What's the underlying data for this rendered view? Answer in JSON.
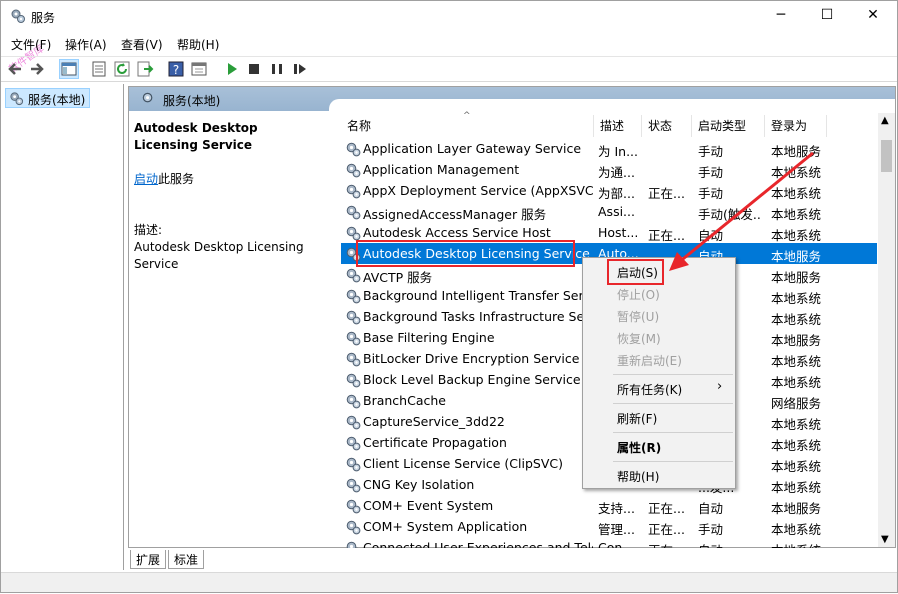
{
  "window": {
    "title": "服务",
    "watermark": "软件智库"
  },
  "menu": [
    "文件(F)",
    "操作(A)",
    "查看(V)",
    "帮助(H)"
  ],
  "tree": {
    "root_label": "服务(本地)"
  },
  "pane": {
    "header": "服务(本地)"
  },
  "description": {
    "service_name": "Autodesk Desktop Licensing Service",
    "start_link": "启动",
    "start_suffix": "此服务",
    "desc_label": "描述:",
    "desc_text": "Autodesk Desktop Licensing Service"
  },
  "columns": [
    "名称",
    "描述",
    "状态",
    "启动类型",
    "登录为"
  ],
  "services": [
    {
      "name": "Application Layer Gateway Service",
      "desc": "为 In...",
      "status": "",
      "startup": "手动",
      "logon": "本地服务"
    },
    {
      "name": "Application Management",
      "desc": "为通...",
      "status": "",
      "startup": "手动",
      "logon": "本地系统"
    },
    {
      "name": "AppX Deployment Service (AppXSVC)",
      "desc": "为部...",
      "status": "正在...",
      "startup": "手动",
      "logon": "本地系统"
    },
    {
      "name": "AssignedAccessManager 服务",
      "desc": "Assi...",
      "status": "",
      "startup": "手动(触发...",
      "logon": "本地系统"
    },
    {
      "name": "Autodesk Access Service Host",
      "desc": "Host...",
      "status": "正在...",
      "startup": "自动",
      "logon": "本地系统"
    },
    {
      "name": "Autodesk Desktop Licensing Service",
      "desc": "Auto...",
      "status": "",
      "startup": "自动",
      "logon": "本地服务"
    },
    {
      "name": "AVCTP 服务",
      "desc": "",
      "status": "",
      "startup": "",
      "logon": "本地服务"
    },
    {
      "name": "Background Intelligent Transfer Service",
      "desc": "",
      "status": "",
      "startup": "",
      "logon": "本地系统"
    },
    {
      "name": "Background Tasks Infrastructure Service",
      "desc": "",
      "status": "",
      "startup": "",
      "logon": "本地系统"
    },
    {
      "name": "Base Filtering Engine",
      "desc": "",
      "status": "",
      "startup": "",
      "logon": "本地服务"
    },
    {
      "name": "BitLocker Drive Encryption Service",
      "desc": "",
      "status": "",
      "startup": "...发...",
      "logon": "本地系统"
    },
    {
      "name": "Block Level Backup Engine Service",
      "desc": "",
      "status": "",
      "startup": "",
      "logon": "本地系统"
    },
    {
      "name": "BranchCache",
      "desc": "",
      "status": "",
      "startup": "",
      "logon": "网络服务"
    },
    {
      "name": "CaptureService_3dd22",
      "desc": "",
      "status": "",
      "startup": "",
      "logon": "本地系统"
    },
    {
      "name": "Certificate Propagation",
      "desc": "",
      "status": "",
      "startup": "",
      "logon": "本地系统"
    },
    {
      "name": "Client License Service (ClipSVC)",
      "desc": "",
      "status": "",
      "startup": "...发...",
      "logon": "本地系统"
    },
    {
      "name": "CNG Key Isolation",
      "desc": "",
      "status": "",
      "startup": "...发...",
      "logon": "本地系统"
    },
    {
      "name": "COM+ Event System",
      "desc": "支持...",
      "status": "正在...",
      "startup": "自动",
      "logon": "本地服务"
    },
    {
      "name": "COM+ System Application",
      "desc": "管理...",
      "status": "正在...",
      "startup": "手动",
      "logon": "本地系统"
    },
    {
      "name": "Connected User Experiences and Tele...",
      "desc": "Con...",
      "status": "正在...",
      "startup": "自动",
      "logon": "本地系统"
    }
  ],
  "context_menu": {
    "start": "启动(S)",
    "stop": "停止(O)",
    "pause": "暂停(U)",
    "resume": "恢复(M)",
    "restart": "重新启动(E)",
    "all_tasks": "所有任务(K)",
    "refresh": "刷新(F)",
    "properties": "属性(R)",
    "help": "帮助(H)"
  },
  "tabs": [
    "扩展",
    "标准"
  ],
  "colors": {
    "selection": "#0078d7",
    "highlight": "#e8262b",
    "header": "#a8c0d8"
  }
}
